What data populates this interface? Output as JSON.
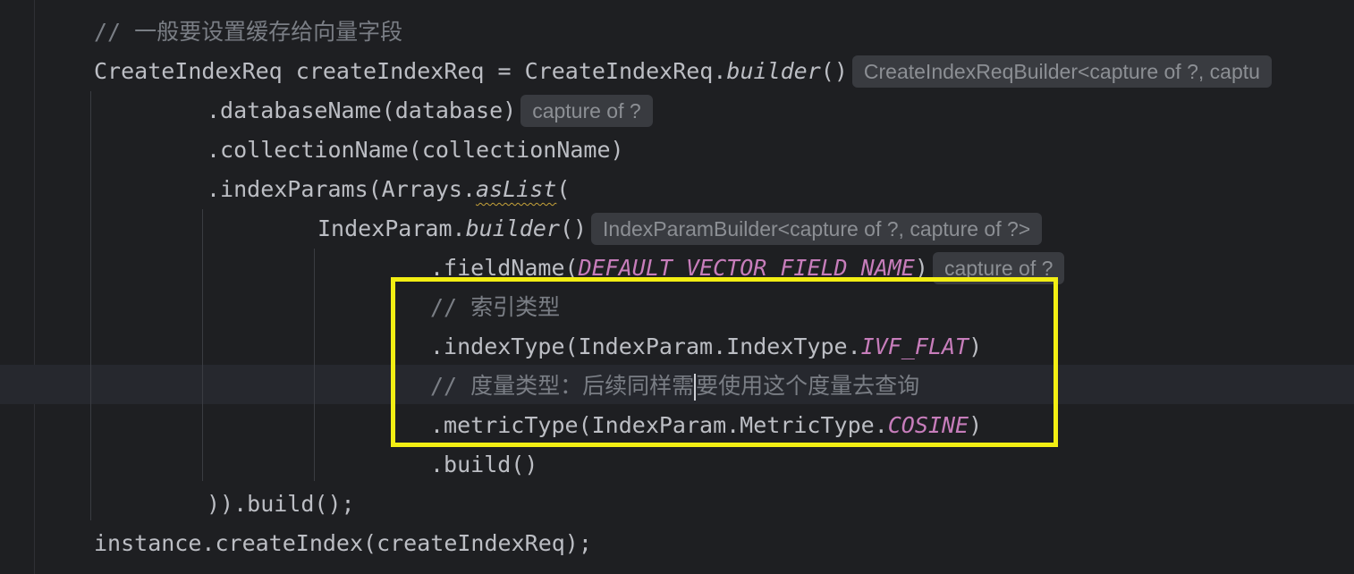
{
  "editor": {
    "lines": [
      {
        "comment": "// 一般要设置缓存给向量字段"
      },
      {
        "code": "CreateIndexReq createIndexReq = CreateIndexReq.",
        "method": "builder",
        "suffix": "()",
        "hint": "CreateIndexReqBuilder<capture of ?, captu"
      },
      {
        "code": ".databaseName(database)",
        "hint": "capture of ?"
      },
      {
        "code": ".collectionName(collectionName)"
      },
      {
        "code": ".indexParams(Arrays.",
        "method": "asList",
        "suffix": "("
      },
      {
        "code": "IndexParam.",
        "method": "builder",
        "suffix": "()",
        "hint": "IndexParamBuilder<capture of ?, capture of ?>"
      },
      {
        "code": ".fieldName(",
        "constant": "DEFAULT_VECTOR_FIELD_NAME",
        "suffix": ")",
        "hint": "capture of ?"
      },
      {
        "comment": "// 索引类型"
      },
      {
        "code": ".indexType(IndexParam.IndexType.",
        "constant": "IVF_FLAT",
        "suffix": ")"
      },
      {
        "comment_before_caret": "// 度量类型：后续同样需",
        "comment_after_caret": "要使用这个度量去查询"
      },
      {
        "code": ".metricType(IndexParam.MetricType.",
        "constant": "COSINE",
        "suffix": ")"
      },
      {
        "code": ".build()"
      },
      {
        "code": ")).build();"
      },
      {
        "code": "instance.createIndex(createIndexReq);"
      }
    ]
  },
  "colors": {
    "background": "#1e1f22",
    "current_line": "#26282e",
    "text": "#bcbec4",
    "comment": "#7a7e85",
    "constant": "#c77dbb",
    "inlay_hint_bg": "#393b40",
    "inlay_hint_text": "#8c8f94",
    "highlight_box": "#f2ee13"
  }
}
